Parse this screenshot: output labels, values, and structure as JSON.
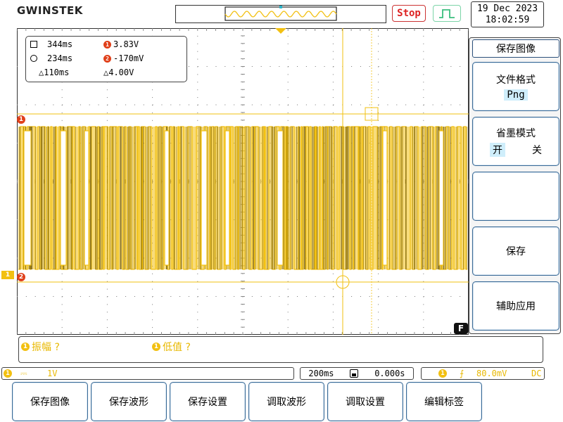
{
  "brand": "GWINSTEK",
  "run_state": "Stop",
  "clock": {
    "date": "19 Dec 2023",
    "time": "18:02:59"
  },
  "cursors": {
    "h1": "344ms",
    "h2": "234ms",
    "dh": "△110ms",
    "v1": "3.83V",
    "v2": "-170mV",
    "dv": "△4.00V",
    "ch1_badge": "1",
    "ch2_badge": "2"
  },
  "markers": {
    "ch1_level": "1",
    "ch1_ground": "1",
    "cursor2": "2",
    "cursor1": "1"
  },
  "menu": {
    "title": "保存图像",
    "items": [
      {
        "label": "文件格式",
        "value": "Png"
      },
      {
        "label": "省墨模式",
        "opt_on": "开",
        "opt_off": "关"
      },
      {
        "label": ""
      },
      {
        "label": "保存"
      },
      {
        "label": "辅助应用"
      }
    ],
    "f_key": "F"
  },
  "measurements": [
    {
      "badge": "1",
      "text": "振幅 ?"
    },
    {
      "badge": "1",
      "text": "低值 ?"
    }
  ],
  "status": {
    "ch_badge": "1",
    "coupling": "⎓",
    "scale": "1V",
    "timebase": "200ms",
    "position": "0.000s",
    "trig_badge": "1",
    "trig_slope": "⨍",
    "trig_level": "80.0mV",
    "trig_coupling": "DC"
  },
  "bottom_menu": [
    "保存图像",
    "保存波形",
    "保存设置",
    "调取波形",
    "调取设置",
    "编辑标签"
  ],
  "colors": {
    "ch1": "#f2c011",
    "accent": "#3a6a96",
    "stop": "#dd2222"
  }
}
